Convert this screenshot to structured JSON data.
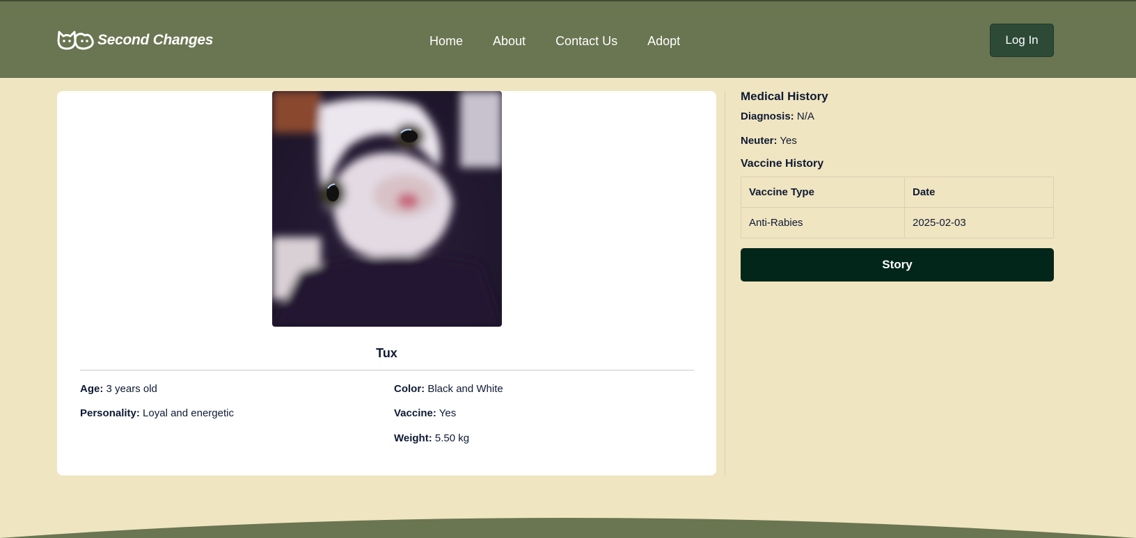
{
  "brand": {
    "name": "Second Changes",
    "logo_icon": "cat-dog-logo-icon"
  },
  "nav": {
    "items": [
      "Home",
      "About",
      "Contact Us",
      "Adopt"
    ],
    "login_label": "Log In"
  },
  "pet": {
    "name": "Tux",
    "attributes_left": [
      {
        "label": "Age:",
        "value": "3 years old"
      },
      {
        "label": "Personality:",
        "value": "Loyal and energetic"
      }
    ],
    "attributes_right": [
      {
        "label": "Color:",
        "value": "Black and White"
      },
      {
        "label": "Vaccine:",
        "value": "Yes"
      },
      {
        "label": "Weight:",
        "value": "5.50 kg"
      }
    ]
  },
  "medical": {
    "title": "Medical History",
    "diagnosis_label": "Diagnosis:",
    "diagnosis_value": "N/A",
    "neuter_label": "Neuter:",
    "neuter_value": "Yes",
    "vaccine_title": "Vaccine History",
    "table": {
      "headers": [
        "Vaccine Type",
        "Date"
      ],
      "rows": [
        [
          "Anti-Rabies",
          "2025-02-03"
        ]
      ]
    },
    "story_label": "Story"
  },
  "colors": {
    "header": "#6a7551",
    "background": "#f0e5c1",
    "dark_button": "#02261a",
    "login_button": "#2c4a36"
  }
}
